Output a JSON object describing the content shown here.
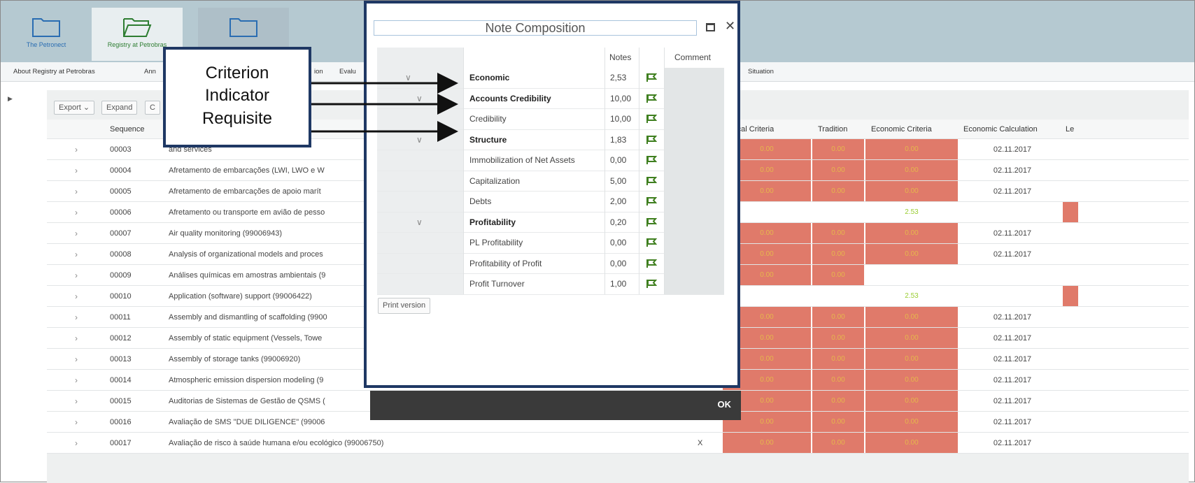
{
  "banner": {
    "apps": [
      {
        "label": "The Petronect"
      },
      {
        "label": "Registry at Petrobras"
      },
      {
        "label": ""
      }
    ]
  },
  "nav": {
    "items": [
      "About Registry at Petrobras",
      "Ann",
      "ion",
      "Evalu",
      "Situation"
    ]
  },
  "toolbar": {
    "export_label": "Export",
    "expand_label": "Expand",
    "c_label": "C"
  },
  "grid": {
    "headers": {
      "sequence": "Sequence",
      "technical": "hnical Criteria",
      "tradition": "Tradition",
      "economic_criteria": "Economic Criteria",
      "economic_calc": "Economic Calculation",
      "le": "Le"
    },
    "rows": [
      {
        "seq": "00003",
        "desc": "and services",
        "x": "",
        "tech": "0.00",
        "trad": "0.00",
        "econ": "0.00",
        "calc": "02.11.2017",
        "style": "red"
      },
      {
        "seq": "00004",
        "desc": "Afretamento de embarcações (LWI, LWO e W",
        "x": "",
        "tech": "0.00",
        "trad": "0.00",
        "econ": "0.00",
        "calc": "02.11.2017",
        "style": "red"
      },
      {
        "seq": "00005",
        "desc": "Afretamento de embarcações de apoio marít",
        "x": "",
        "tech": "0.00",
        "trad": "0.00",
        "econ": "0.00",
        "calc": "02.11.2017",
        "style": "red"
      },
      {
        "seq": "00006",
        "desc": "Afretamento ou transporte em avião de pesso",
        "x": "",
        "tech": "",
        "trad": "",
        "econ": "2.53",
        "calc": "",
        "style": "green"
      },
      {
        "seq": "00007",
        "desc": "Air quality monitoring (99006943)",
        "x": "",
        "tech": "0.00",
        "trad": "0.00",
        "econ": "0.00",
        "calc": "02.11.2017",
        "style": "red"
      },
      {
        "seq": "00008",
        "desc": "Analysis of organizational models and proces",
        "x": "",
        "tech": "0.00",
        "trad": "0.00",
        "econ": "0.00",
        "calc": "02.11.2017",
        "style": "red"
      },
      {
        "seq": "00009",
        "desc": "Análises químicas em amostras ambientais (9",
        "x": "",
        "tech": "0.00",
        "trad": "0.00",
        "econ": "",
        "calc": "",
        "style": "partial"
      },
      {
        "seq": "00010",
        "desc": "Application (software) support (99006422)",
        "x": "",
        "tech": "",
        "trad": "",
        "econ": "2.53",
        "calc": "",
        "style": "green"
      },
      {
        "seq": "00011",
        "desc": "Assembly and dismantling of scaffolding (9900",
        "x": "",
        "tech": "0.00",
        "trad": "0.00",
        "econ": "0.00",
        "calc": "02.11.2017",
        "style": "red"
      },
      {
        "seq": "00012",
        "desc": "Assembly of static equipment (Vessels, Towe",
        "x": "",
        "tech": "0.00",
        "trad": "0.00",
        "econ": "0.00",
        "calc": "02.11.2017",
        "style": "red"
      },
      {
        "seq": "00013",
        "desc": "Assembly of storage tanks (99006920)",
        "x": "",
        "tech": "0.00",
        "trad": "0.00",
        "econ": "0.00",
        "calc": "02.11.2017",
        "style": "red"
      },
      {
        "seq": "00014",
        "desc": "Atmospheric emission dispersion modeling (9",
        "x": "",
        "tech": "0.00",
        "trad": "0.00",
        "econ": "0.00",
        "calc": "02.11.2017",
        "style": "red"
      },
      {
        "seq": "00015",
        "desc": "Auditorias de Sistemas de Gestão de QSMS (",
        "x": "",
        "tech": "0.00",
        "trad": "0.00",
        "econ": "0.00",
        "calc": "02.11.2017",
        "style": "red"
      },
      {
        "seq": "00016",
        "desc": "Avaliação de SMS \"DUE DILIGENCE\" (99006",
        "x": "",
        "tech": "0.00",
        "trad": "0.00",
        "econ": "0.00",
        "calc": "02.11.2017",
        "style": "red"
      },
      {
        "seq": "00017",
        "desc": "Avaliação de risco à saúde humana e/ou ecológico (99006750)",
        "x": "X",
        "tech": "0.00",
        "trad": "0.00",
        "econ": "0.00",
        "calc": "02.11.2017",
        "style": "red"
      }
    ]
  },
  "callout": {
    "line1": "Criterion",
    "line2": "Indicator",
    "line3": "Requisite"
  },
  "modal": {
    "title": "Note Composition",
    "headers": {
      "notes": "Notes",
      "comment": "Comment"
    },
    "rows": [
      {
        "name": "Economic",
        "note": "2,53",
        "bold": true,
        "chev": "∨",
        "level": 0
      },
      {
        "name": "Accounts Credibility",
        "note": "10,00",
        "bold": true,
        "chev": "∨",
        "level": 1
      },
      {
        "name": "Credibility",
        "note": "10,00",
        "bold": false,
        "chev": "",
        "level": 2
      },
      {
        "name": "Structure",
        "note": "1,83",
        "bold": true,
        "chev": "∨",
        "level": 1
      },
      {
        "name": "Immobilization of Net Assets",
        "note": "0,00",
        "bold": false,
        "chev": "",
        "level": 2
      },
      {
        "name": "Capitalization",
        "note": "5,00",
        "bold": false,
        "chev": "",
        "level": 2
      },
      {
        "name": "Debts",
        "note": "2,00",
        "bold": false,
        "chev": "",
        "level": 2
      },
      {
        "name": "Profitability",
        "note": "0,20",
        "bold": true,
        "chev": "∨",
        "level": 1
      },
      {
        "name": "PL Profitability",
        "note": "0,00",
        "bold": false,
        "chev": "",
        "level": 2
      },
      {
        "name": "Profitability of Profit",
        "note": "0,00",
        "bold": false,
        "chev": "",
        "level": 2
      },
      {
        "name": "Profit Turnover",
        "note": "1,00",
        "bold": false,
        "chev": "",
        "level": 2
      }
    ],
    "print_label": "Print version",
    "ok_label": "OK"
  },
  "colors": {
    "banner": "#b5c9d1",
    "callout_border": "#1f3864",
    "red_cell": "#e07a6a",
    "flag_green": "#3f7f1f",
    "footer": "#3a3a3a"
  }
}
